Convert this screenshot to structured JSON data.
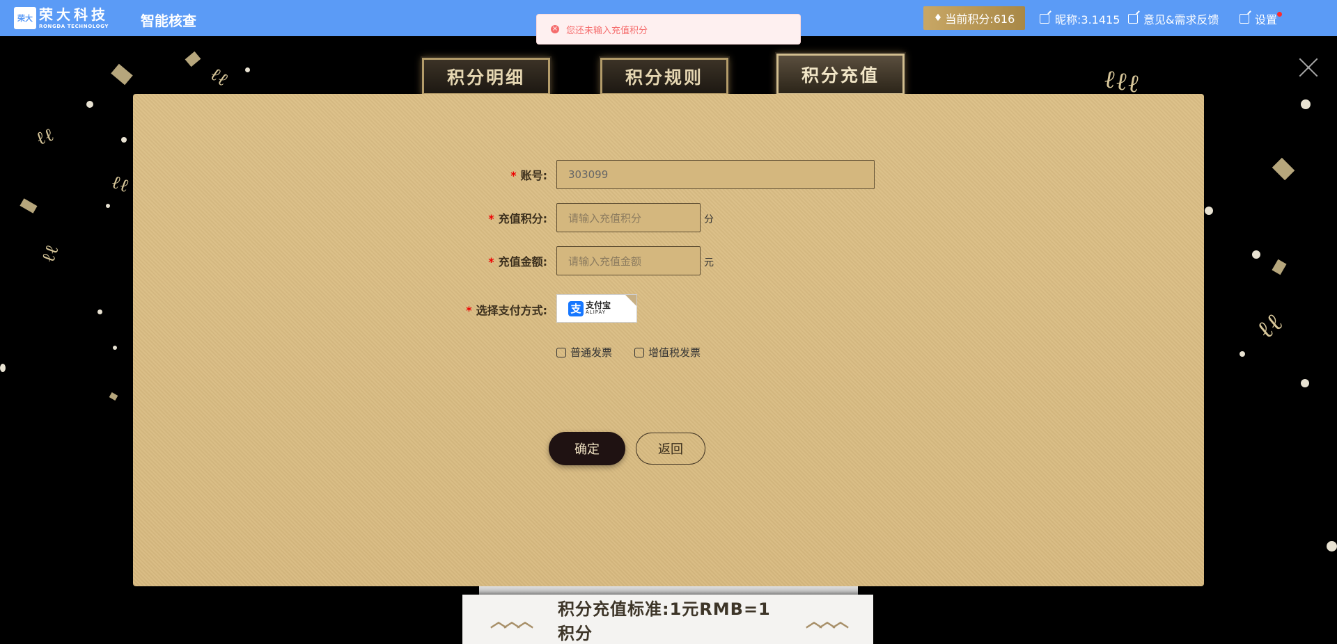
{
  "header": {
    "logo_mark": "荣大",
    "logo_cn": "荣大科技",
    "logo_en": "RONGDA TECHNOLOGY",
    "app_title": "智能核查",
    "points_label": "当前积分:616",
    "nickname_label": "昵称:3.1415",
    "feedback_label": "意见&需求反馈",
    "settings_label": "设置"
  },
  "toast": {
    "message": "您还未输入充值积分"
  },
  "tabs": [
    {
      "label": "积分明细"
    },
    {
      "label": "积分规则"
    },
    {
      "label": "积分充值"
    }
  ],
  "form": {
    "account": {
      "label": "账号:",
      "value": "303099"
    },
    "points": {
      "label": "充值积分:",
      "placeholder": "请输入充值积分",
      "unit": "分"
    },
    "amount": {
      "label": "充值金额:",
      "placeholder": "请输入充值金额",
      "unit": "元"
    },
    "payment": {
      "label": "选择支付方式:",
      "alipay_cn": "支付宝",
      "alipay_en": "ALIPAY"
    },
    "invoice_normal": "普通发票",
    "invoice_vat": "增值税发票",
    "confirm_label": "确定",
    "back_label": "返回",
    "required_mark": "*"
  },
  "banner": {
    "text": "积分充值标准:1元RMB=1积分"
  },
  "colors": {
    "topbar": "#5b9bf6",
    "panel": "#dcbe85",
    "error": "#f56c6c"
  }
}
